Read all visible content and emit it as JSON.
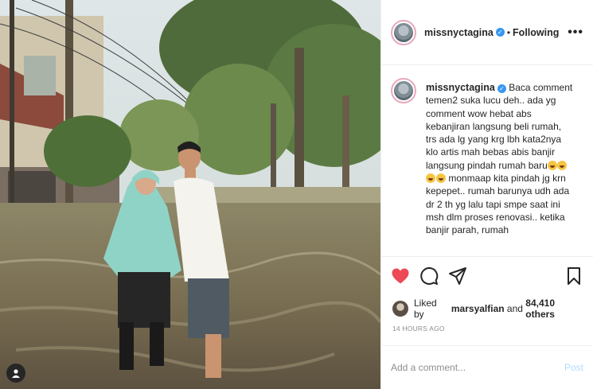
{
  "post": {
    "username": "missnyctagina",
    "verified": true,
    "separator": "•",
    "follow_status": "Following",
    "more_label": "•••",
    "caption": {
      "username": "missnyctagina",
      "text_1": "Baca comment temen2 suka lucu deh.. ada yg comment wow hebat abs kebanjiran langsung beli rumah, trs ada lg yang krg lbh kata2nya klo artis mah bebas abis banjir langsung pindah rumah baru",
      "emoji": [
        "grimacing-face",
        "grimacing-face",
        "grimacing-face",
        "grimacing-face"
      ],
      "text_2": " monmaap kita pindah jg krn kepepet.. rumah barunya udh ada dr 2 th yg lalu tapi smpe saat ini msh dlm proses renovasi.. ketika banjir parah, rumah"
    },
    "likes": {
      "prefix": "Liked by",
      "user": "marsyalfian",
      "connector": "and",
      "count": "84,410 others"
    },
    "timestamp": "14 HOURS AGO",
    "comment": {
      "placeholder": "Add a comment...",
      "post_label": "Post"
    }
  },
  "icons": {
    "like": "heart-filled-icon",
    "comment": "comment-bubble-icon",
    "share": "paper-plane-icon",
    "save": "bookmark-icon",
    "tag": "user-tag-icon"
  },
  "colors": {
    "like_red": "#ed4956",
    "verified_blue": "#3897f0",
    "post_disabled": "#b3dbff",
    "meta_gray": "#8e8e8e"
  }
}
